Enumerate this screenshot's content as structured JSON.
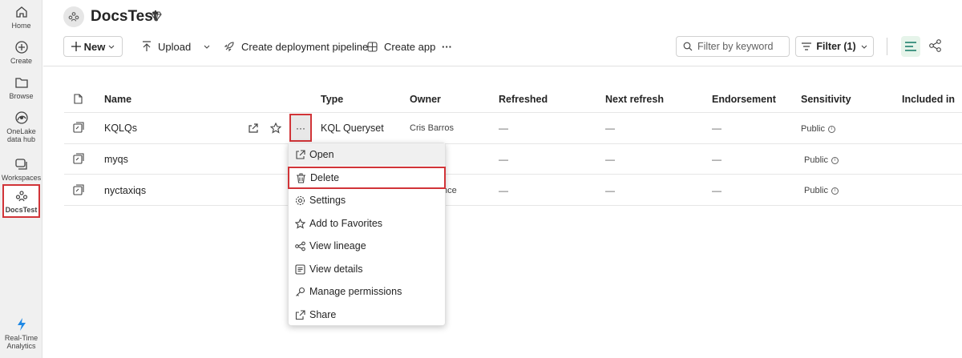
{
  "rail": {
    "items": [
      {
        "label": "Home",
        "icon": "home-icon"
      },
      {
        "label": "Create",
        "icon": "plus-circle-icon"
      },
      {
        "label": "Browse",
        "icon": "folder-icon"
      },
      {
        "label": "OneLake\ndata hub",
        "icon": "onelake-icon"
      },
      {
        "label": "Workspaces",
        "icon": "workspaces-icon"
      },
      {
        "label": "DocsTest",
        "icon": "workspace-people-icon"
      },
      {
        "label": "Real-Time\nAnalytics",
        "icon": "lightning-icon"
      }
    ]
  },
  "header": {
    "title": "DocsTest"
  },
  "toolbar": {
    "new_label": "New",
    "upload_label": "Upload",
    "pipeline_label": "Create deployment pipeline",
    "create_app_label": "Create app",
    "more_label": "···",
    "search_placeholder": "Filter by keyword",
    "filter_label": "Filter (1)"
  },
  "table": {
    "columns": [
      "Name",
      "Type",
      "Owner",
      "Refreshed",
      "Next refresh",
      "Endorsement",
      "Sensitivity",
      "Included in"
    ],
    "rows": [
      {
        "name": "KQLQs",
        "type": "KQL Queryset",
        "owner": "Cris Barros",
        "refreshed": "—",
        "next_refresh": "—",
        "endorsement": "—",
        "sensitivity": "Public"
      },
      {
        "name": "myqs",
        "type": "",
        "owner": "",
        "refreshed": "—",
        "next_refresh": "—",
        "endorsement": "—",
        "sensitivity": "Public"
      },
      {
        "name": "nyctaxiqs",
        "type": "",
        "owner": "nce",
        "refreshed": "—",
        "next_refresh": "—",
        "endorsement": "—",
        "sensitivity": "Public"
      }
    ],
    "more_label": "···"
  },
  "context_menu": {
    "items": [
      {
        "label": "Open",
        "icon": "open-external-icon"
      },
      {
        "label": "Delete",
        "icon": "trash-icon"
      },
      {
        "label": "Settings",
        "icon": "gear-icon"
      },
      {
        "label": "Add to Favorites",
        "icon": "star-icon"
      },
      {
        "label": "View lineage",
        "icon": "lineage-icon"
      },
      {
        "label": "View details",
        "icon": "details-icon"
      },
      {
        "label": "Manage permissions",
        "icon": "key-icon"
      },
      {
        "label": "Share",
        "icon": "share-icon"
      }
    ]
  },
  "colors": {
    "highlight": "#d13438",
    "accent": "#117865"
  }
}
